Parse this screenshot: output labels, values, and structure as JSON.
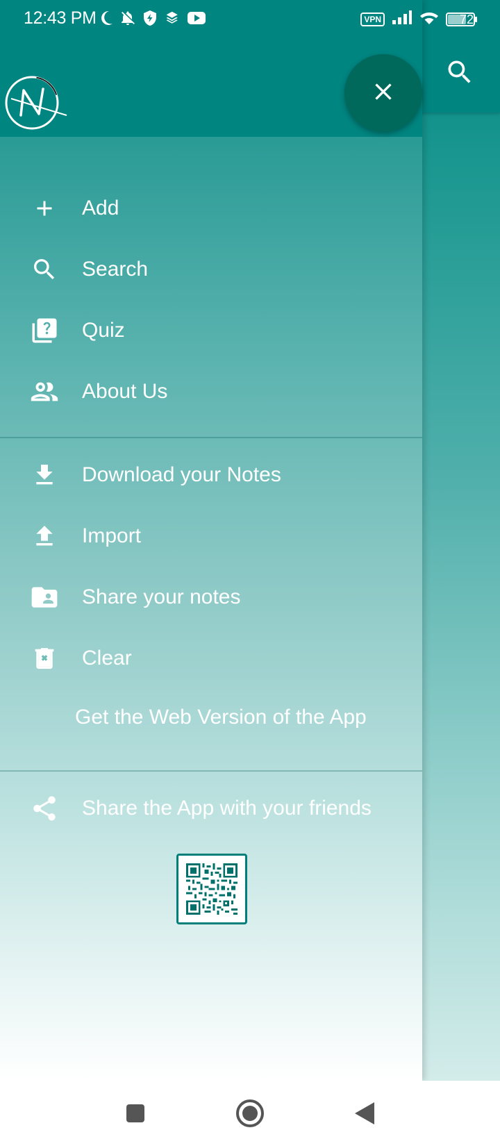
{
  "status_bar": {
    "time": "12:43 PM",
    "vpn_label": "VPN",
    "battery_level": "72",
    "left_icons": [
      "moon-icon",
      "bell-off-icon",
      "shield-icon",
      "layers-icon",
      "youtube-icon"
    ],
    "right_icons": [
      "vpn-badge",
      "signal-icon",
      "wifi-icon",
      "battery-icon"
    ]
  },
  "drawer": {
    "logo_letter": "N",
    "close_icon": "close-icon",
    "main_items": [
      {
        "label": "Add",
        "icon": "plus-icon"
      },
      {
        "label": "Search",
        "icon": "search-icon"
      },
      {
        "label": "Quiz",
        "icon": "quiz-icon"
      },
      {
        "label": "About Us",
        "icon": "people-icon"
      }
    ],
    "note_items": [
      {
        "label": "Download your Notes",
        "icon": "download-icon"
      },
      {
        "label": "Import",
        "icon": "upload-icon"
      },
      {
        "label": "Share your notes",
        "icon": "folder-shared-icon"
      },
      {
        "label": "Clear",
        "icon": "trash-icon"
      }
    ],
    "web_version_label": "Get the Web Version of the App",
    "share_app_label": "Share the App with your friends",
    "share_app_icon": "share-icon",
    "qr_icon": "qr-code-icon"
  },
  "background_app": {
    "search_icon": "search-icon"
  },
  "nav_bar": {
    "buttons": [
      "recents-icon",
      "home-icon",
      "back-icon"
    ]
  },
  "colors": {
    "primary": "#008580",
    "fab": "#00695c",
    "text": "#ffffff"
  }
}
